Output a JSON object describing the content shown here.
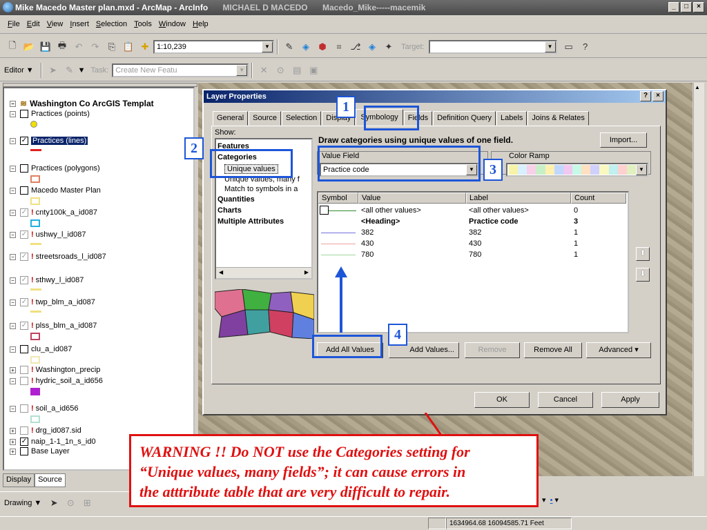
{
  "window": {
    "title": "Mike Macedo Master plan.mxd - ArcMap - ArcInfo",
    "user": "MICHAEL D MACEDO",
    "session": "Macedo_Mike-----macemik"
  },
  "menu": [
    "File",
    "Edit",
    "View",
    "Insert",
    "Selection",
    "Tools",
    "Window",
    "Help"
  ],
  "toolbar": {
    "scale": "1:10,239",
    "target_label": "Target:"
  },
  "editor": {
    "label": "Editor",
    "task_label": "Task:",
    "task_value": "Create New Featu"
  },
  "toc": {
    "root": "Washington Co ArcGIS Templat",
    "layers": [
      {
        "name": "Practices (points)",
        "checked": false,
        "warn": false
      },
      {
        "name": "Practices (lines)",
        "checked": true,
        "warn": false,
        "selected": true
      },
      {
        "name": "Practices (polygons)",
        "checked": false,
        "warn": false
      },
      {
        "name": "Macedo Master Plan",
        "checked": false,
        "warn": false
      },
      {
        "name": "cnty100k_a_id087",
        "checked": true,
        "warn": true
      },
      {
        "name": "ushwy_l_id087",
        "checked": true,
        "warn": true
      },
      {
        "name": "streetsroads_l_id087",
        "checked": true,
        "warn": true
      },
      {
        "name": "sthwy_l_id087",
        "checked": true,
        "warn": true
      },
      {
        "name": "twp_blm_a_id087",
        "checked": true,
        "warn": true
      },
      {
        "name": "plss_blm_a_id087",
        "checked": true,
        "warn": true
      },
      {
        "name": "clu_a_id087",
        "checked": false,
        "warn": false
      },
      {
        "name": "Washington_precip",
        "checked": false,
        "warn": true
      },
      {
        "name": "hydric_soil_a_id656",
        "checked": false,
        "warn": true
      },
      {
        "name": "soil_a_id656",
        "checked": false,
        "warn": true
      },
      {
        "name": "drg_id087.sid",
        "checked": false,
        "warn": true
      },
      {
        "name": "naip_1-1_1n_s_id0",
        "checked": true,
        "warn": false
      },
      {
        "name": "Base Layer",
        "checked": false,
        "warn": false
      }
    ],
    "tabs": [
      "Display",
      "Source"
    ]
  },
  "drawing_label": "Drawing",
  "dialog": {
    "title": "Layer Properties",
    "tabs": [
      "General",
      "Source",
      "Selection",
      "Display",
      "Symbology",
      "Fields",
      "Definition Query",
      "Labels",
      "Joins & Relates"
    ],
    "show_label": "Show:",
    "show_items": [
      "Features",
      "Categories",
      "Unique values",
      "Unique values, many f",
      "Match to symbols in a",
      "Quantities",
      "Charts",
      "Multiple Attributes"
    ],
    "heading": "Draw categories using unique values of one field.",
    "import_label": "Import...",
    "value_field_label": "Value Field",
    "value_field": "Practice code",
    "color_ramp_label": "Color Ramp",
    "columns": [
      "Symbol",
      "Value",
      "Label",
      "Count"
    ],
    "rows": [
      {
        "value": "<all other values>",
        "label": "<all other values>",
        "count": "0",
        "color": "#2e8b2e",
        "bold": false
      },
      {
        "value": "<Heading>",
        "label": "Practice code",
        "count": "3",
        "color": "",
        "bold": true
      },
      {
        "value": "382",
        "label": "382",
        "count": "1",
        "color": "#7070e0",
        "bold": false
      },
      {
        "value": "430",
        "label": "430",
        "count": "1",
        "color": "#f0a0a0",
        "bold": false
      },
      {
        "value": "780",
        "label": "780",
        "count": "1",
        "color": "#a0d8a0",
        "bold": false
      }
    ],
    "buttons": {
      "add_all": "Add All Values",
      "add": "Add Values...",
      "remove": "Remove",
      "remove_all": "Remove All",
      "advanced": "Advanced",
      "ok": "OK",
      "cancel": "Cancel",
      "apply": "Apply"
    }
  },
  "callouts": [
    "1",
    "2",
    "3",
    "4"
  ],
  "warning": {
    "line1": "WARNING !!  Do NOT use the Categories setting for",
    "line2": "“Unique values, many fields”; it can cause errors in",
    "line3": "the atttribute table that are very difficult to repair."
  },
  "status": {
    "coords": "1634964.68  16094585.71 Feet"
  },
  "colors": {
    "callout": "#1c55d8",
    "warning": "#e01010"
  }
}
